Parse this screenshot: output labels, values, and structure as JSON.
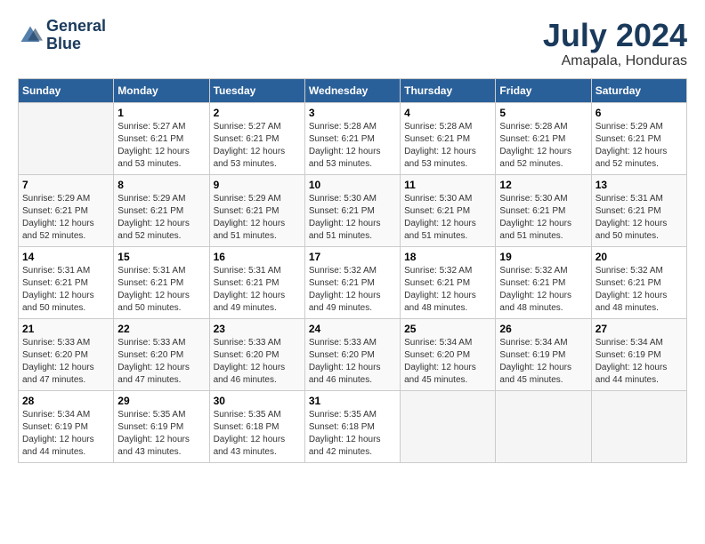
{
  "logo": {
    "line1": "General",
    "line2": "Blue"
  },
  "title": {
    "month_year": "July 2024",
    "location": "Amapala, Honduras"
  },
  "headers": [
    "Sunday",
    "Monday",
    "Tuesday",
    "Wednesday",
    "Thursday",
    "Friday",
    "Saturday"
  ],
  "weeks": [
    [
      {
        "day": "",
        "info": ""
      },
      {
        "day": "1",
        "info": "Sunrise: 5:27 AM\nSunset: 6:21 PM\nDaylight: 12 hours\nand 53 minutes."
      },
      {
        "day": "2",
        "info": "Sunrise: 5:27 AM\nSunset: 6:21 PM\nDaylight: 12 hours\nand 53 minutes."
      },
      {
        "day": "3",
        "info": "Sunrise: 5:28 AM\nSunset: 6:21 PM\nDaylight: 12 hours\nand 53 minutes."
      },
      {
        "day": "4",
        "info": "Sunrise: 5:28 AM\nSunset: 6:21 PM\nDaylight: 12 hours\nand 53 minutes."
      },
      {
        "day": "5",
        "info": "Sunrise: 5:28 AM\nSunset: 6:21 PM\nDaylight: 12 hours\nand 52 minutes."
      },
      {
        "day": "6",
        "info": "Sunrise: 5:29 AM\nSunset: 6:21 PM\nDaylight: 12 hours\nand 52 minutes."
      }
    ],
    [
      {
        "day": "7",
        "info": "Sunrise: 5:29 AM\nSunset: 6:21 PM\nDaylight: 12 hours\nand 52 minutes."
      },
      {
        "day": "8",
        "info": "Sunrise: 5:29 AM\nSunset: 6:21 PM\nDaylight: 12 hours\nand 52 minutes."
      },
      {
        "day": "9",
        "info": "Sunrise: 5:29 AM\nSunset: 6:21 PM\nDaylight: 12 hours\nand 51 minutes."
      },
      {
        "day": "10",
        "info": "Sunrise: 5:30 AM\nSunset: 6:21 PM\nDaylight: 12 hours\nand 51 minutes."
      },
      {
        "day": "11",
        "info": "Sunrise: 5:30 AM\nSunset: 6:21 PM\nDaylight: 12 hours\nand 51 minutes."
      },
      {
        "day": "12",
        "info": "Sunrise: 5:30 AM\nSunset: 6:21 PM\nDaylight: 12 hours\nand 51 minutes."
      },
      {
        "day": "13",
        "info": "Sunrise: 5:31 AM\nSunset: 6:21 PM\nDaylight: 12 hours\nand 50 minutes."
      }
    ],
    [
      {
        "day": "14",
        "info": "Sunrise: 5:31 AM\nSunset: 6:21 PM\nDaylight: 12 hours\nand 50 minutes."
      },
      {
        "day": "15",
        "info": "Sunrise: 5:31 AM\nSunset: 6:21 PM\nDaylight: 12 hours\nand 50 minutes."
      },
      {
        "day": "16",
        "info": "Sunrise: 5:31 AM\nSunset: 6:21 PM\nDaylight: 12 hours\nand 49 minutes."
      },
      {
        "day": "17",
        "info": "Sunrise: 5:32 AM\nSunset: 6:21 PM\nDaylight: 12 hours\nand 49 minutes."
      },
      {
        "day": "18",
        "info": "Sunrise: 5:32 AM\nSunset: 6:21 PM\nDaylight: 12 hours\nand 48 minutes."
      },
      {
        "day": "19",
        "info": "Sunrise: 5:32 AM\nSunset: 6:21 PM\nDaylight: 12 hours\nand 48 minutes."
      },
      {
        "day": "20",
        "info": "Sunrise: 5:32 AM\nSunset: 6:21 PM\nDaylight: 12 hours\nand 48 minutes."
      }
    ],
    [
      {
        "day": "21",
        "info": "Sunrise: 5:33 AM\nSunset: 6:20 PM\nDaylight: 12 hours\nand 47 minutes."
      },
      {
        "day": "22",
        "info": "Sunrise: 5:33 AM\nSunset: 6:20 PM\nDaylight: 12 hours\nand 47 minutes."
      },
      {
        "day": "23",
        "info": "Sunrise: 5:33 AM\nSunset: 6:20 PM\nDaylight: 12 hours\nand 46 minutes."
      },
      {
        "day": "24",
        "info": "Sunrise: 5:33 AM\nSunset: 6:20 PM\nDaylight: 12 hours\nand 46 minutes."
      },
      {
        "day": "25",
        "info": "Sunrise: 5:34 AM\nSunset: 6:20 PM\nDaylight: 12 hours\nand 45 minutes."
      },
      {
        "day": "26",
        "info": "Sunrise: 5:34 AM\nSunset: 6:19 PM\nDaylight: 12 hours\nand 45 minutes."
      },
      {
        "day": "27",
        "info": "Sunrise: 5:34 AM\nSunset: 6:19 PM\nDaylight: 12 hours\nand 44 minutes."
      }
    ],
    [
      {
        "day": "28",
        "info": "Sunrise: 5:34 AM\nSunset: 6:19 PM\nDaylight: 12 hours\nand 44 minutes."
      },
      {
        "day": "29",
        "info": "Sunrise: 5:35 AM\nSunset: 6:19 PM\nDaylight: 12 hours\nand 43 minutes."
      },
      {
        "day": "30",
        "info": "Sunrise: 5:35 AM\nSunset: 6:18 PM\nDaylight: 12 hours\nand 43 minutes."
      },
      {
        "day": "31",
        "info": "Sunrise: 5:35 AM\nSunset: 6:18 PM\nDaylight: 12 hours\nand 42 minutes."
      },
      {
        "day": "",
        "info": ""
      },
      {
        "day": "",
        "info": ""
      },
      {
        "day": "",
        "info": ""
      }
    ]
  ]
}
